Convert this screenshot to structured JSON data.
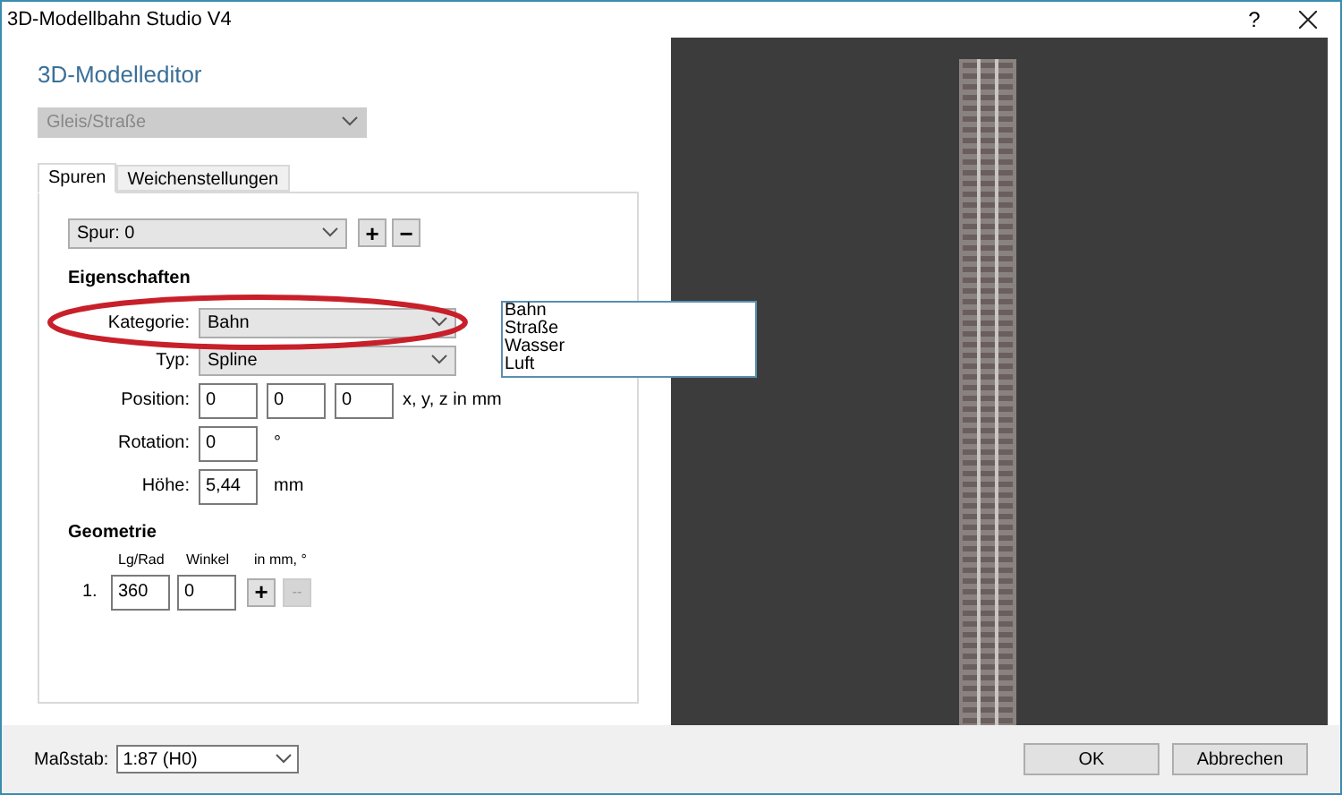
{
  "window": {
    "title": "3D-Modellbahn Studio V4",
    "help": "?"
  },
  "heading": "3D-Modelleditor",
  "object_type": {
    "value": "Gleis/Straße",
    "disabled": true
  },
  "tabs": [
    {
      "label": "Spuren",
      "selected": true
    },
    {
      "label": "Weichenstellungen",
      "selected": false
    }
  ],
  "track_select": {
    "value": "Spur: 0",
    "add": "+",
    "remove": "−"
  },
  "properties": {
    "title": "Eigenschaften",
    "category": {
      "label": "Kategorie:",
      "value": "Bahn"
    },
    "type": {
      "label": "Typ:",
      "value": "Spline"
    },
    "position": {
      "label": "Position:",
      "values": [
        "0",
        "0",
        "0"
      ],
      "unit": "x, y, z in mm"
    },
    "rotation": {
      "label": "Rotation:",
      "value": "0",
      "unit": "°"
    },
    "height": {
      "label": "Höhe:",
      "value": "5,44",
      "unit": "mm"
    }
  },
  "geometry": {
    "title": "Geometrie",
    "columns": [
      "Lg/Rad",
      "Winkel",
      "in mm, °"
    ],
    "rows": [
      {
        "index": "1.",
        "length": "360",
        "angle": "0",
        "add": "+",
        "remove": "--",
        "remove_disabled": true
      }
    ]
  },
  "category_list": [
    "Bahn",
    "Straße",
    "Wasser",
    "Luft"
  ],
  "footer": {
    "scale_label": "Maßstab:",
    "scale_value": "1:87 (H0)",
    "buttons": [
      "OK",
      "Abbrechen"
    ]
  }
}
